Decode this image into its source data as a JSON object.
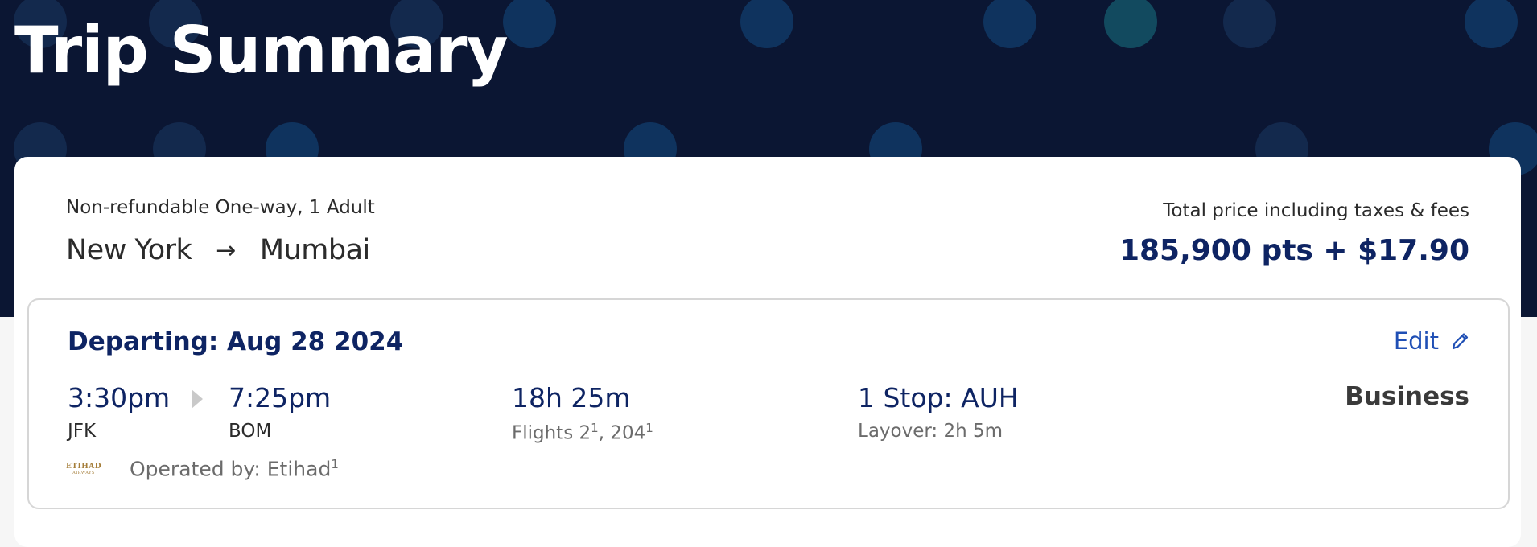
{
  "page": {
    "title": "Trip Summary"
  },
  "summary": {
    "fare_type": "Non-refundable One-way, 1 Adult",
    "origin_city": "New York",
    "arrow": "→",
    "destination_city": "Mumbai",
    "price_label": "Total price including taxes & fees",
    "price": "185,900 pts + $17.90"
  },
  "segment": {
    "departing": "Departing: Aug 28 2024",
    "edit_label": "Edit",
    "depart_time": "3:30pm",
    "depart_airport": "JFK",
    "arrive_time": "7:25pm",
    "arrive_airport": "BOM",
    "duration": "18h 25m",
    "flights_prefix": "Flights 2",
    "flight_1_sup": "1",
    "flights_mid": ", 204",
    "flight_2_sup": "1",
    "stops": "1 Stop: AUH",
    "layover": "Layover: 2h 5m",
    "cabin": "Business",
    "operated_by": "Operated by: Etihad",
    "operated_sup": "1",
    "airline_logo_text": "ETIHAD",
    "airline_logo_sub": "AIRWAYS"
  },
  "icons": {
    "edit": "pencil-icon",
    "direction": "play-icon",
    "airline": "etihad-logo"
  },
  "colors": {
    "hero_bg": "#0b1633",
    "accent_navy": "#0e2463",
    "link_blue": "#1f4fb5",
    "card_bg": "#ffffff"
  }
}
